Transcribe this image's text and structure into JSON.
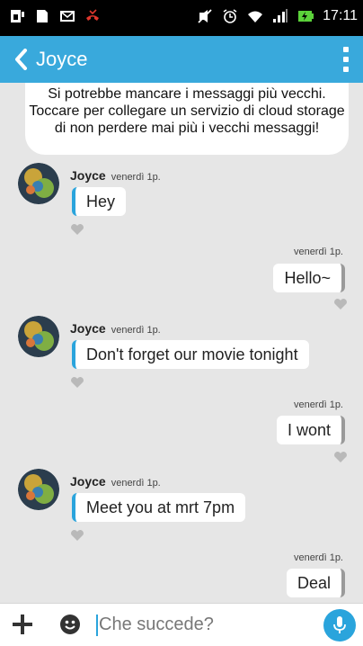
{
  "status_bar": {
    "time": "17:11",
    "icons": [
      "sim-icon",
      "sd-card-icon",
      "email-icon",
      "missed-call-icon",
      "mute-icon",
      "alarm-icon",
      "wifi-icon",
      "signal-icon",
      "battery-charging-icon"
    ],
    "colors": {
      "missed_call": "#e0372d",
      "battery": "#5bd23a"
    }
  },
  "header": {
    "title": "Joyce",
    "bg_color": "#39a9dc"
  },
  "banner": {
    "text": "Si potrebbe mancare i messaggi più vecchi. Toccare per collegare un servizio di cloud storage di non perdere mai più i vecchi messaggi!"
  },
  "messages": [
    {
      "direction": "in",
      "sender": "Joyce",
      "time": "venerdì 1p.",
      "text": "Hey"
    },
    {
      "direction": "out",
      "time": "venerdì 1p.",
      "text": "Hello~"
    },
    {
      "direction": "in",
      "sender": "Joyce",
      "time": "venerdì 1p.",
      "text": "Don't forget our movie tonight"
    },
    {
      "direction": "out",
      "time": "venerdì 1p.",
      "text": "I wont"
    },
    {
      "direction": "in",
      "sender": "Joyce",
      "time": "venerdì 1p.",
      "text": "Meet you at mrt 7pm"
    },
    {
      "direction": "out",
      "time": "venerdì 1p.",
      "text": "Deal"
    }
  ],
  "input": {
    "placeholder": "Che succede?"
  },
  "colors": {
    "accent": "#2aa4dc",
    "background": "#e6e6e6"
  }
}
